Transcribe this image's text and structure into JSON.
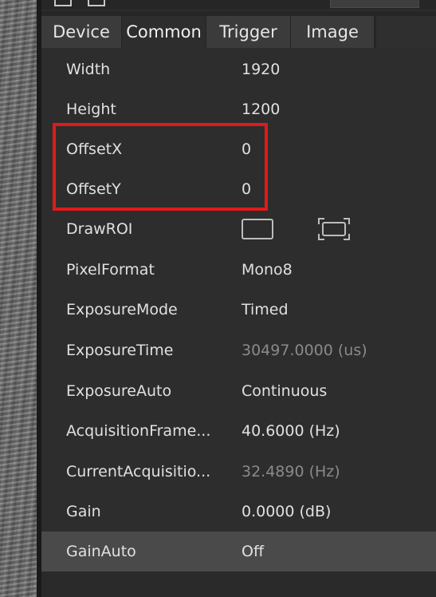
{
  "tabs": [
    {
      "label": "Device",
      "active": false
    },
    {
      "label": "Common",
      "active": true
    },
    {
      "label": "Trigger",
      "active": false
    },
    {
      "label": "Image",
      "active": false
    }
  ],
  "properties": [
    {
      "label": "Width",
      "value": "1920"
    },
    {
      "label": "Height",
      "value": "1200"
    },
    {
      "label": "OffsetX",
      "value": "0"
    },
    {
      "label": "OffsetY",
      "value": "0"
    },
    {
      "label": "DrawROI",
      "value": ""
    },
    {
      "label": "PixelFormat",
      "value": "Mono8"
    },
    {
      "label": "ExposureMode",
      "value": "Timed"
    },
    {
      "label": "ExposureTime",
      "value": "30497.0000 (us)"
    },
    {
      "label": "ExposureAuto",
      "value": "Continuous"
    },
    {
      "label": "AcquisitionFrame...",
      "value": "40.6000 (Hz)"
    },
    {
      "label": "CurrentAcquisitio...",
      "value": "32.4890 (Hz)"
    },
    {
      "label": "Gain",
      "value": "0.0000 (dB)"
    },
    {
      "label": "GainAuto",
      "value": "Off"
    }
  ],
  "icons": {
    "roi_draw": "rectangle-draw-icon",
    "roi_fullscreen": "fit-roi-icon"
  },
  "colors": {
    "highlight": "#e01a1a",
    "panel_bg": "#2d2d2d",
    "selected_row": "#4a4a4a",
    "text": "#e0e0e0",
    "dim_text": "#8a8a8a"
  }
}
